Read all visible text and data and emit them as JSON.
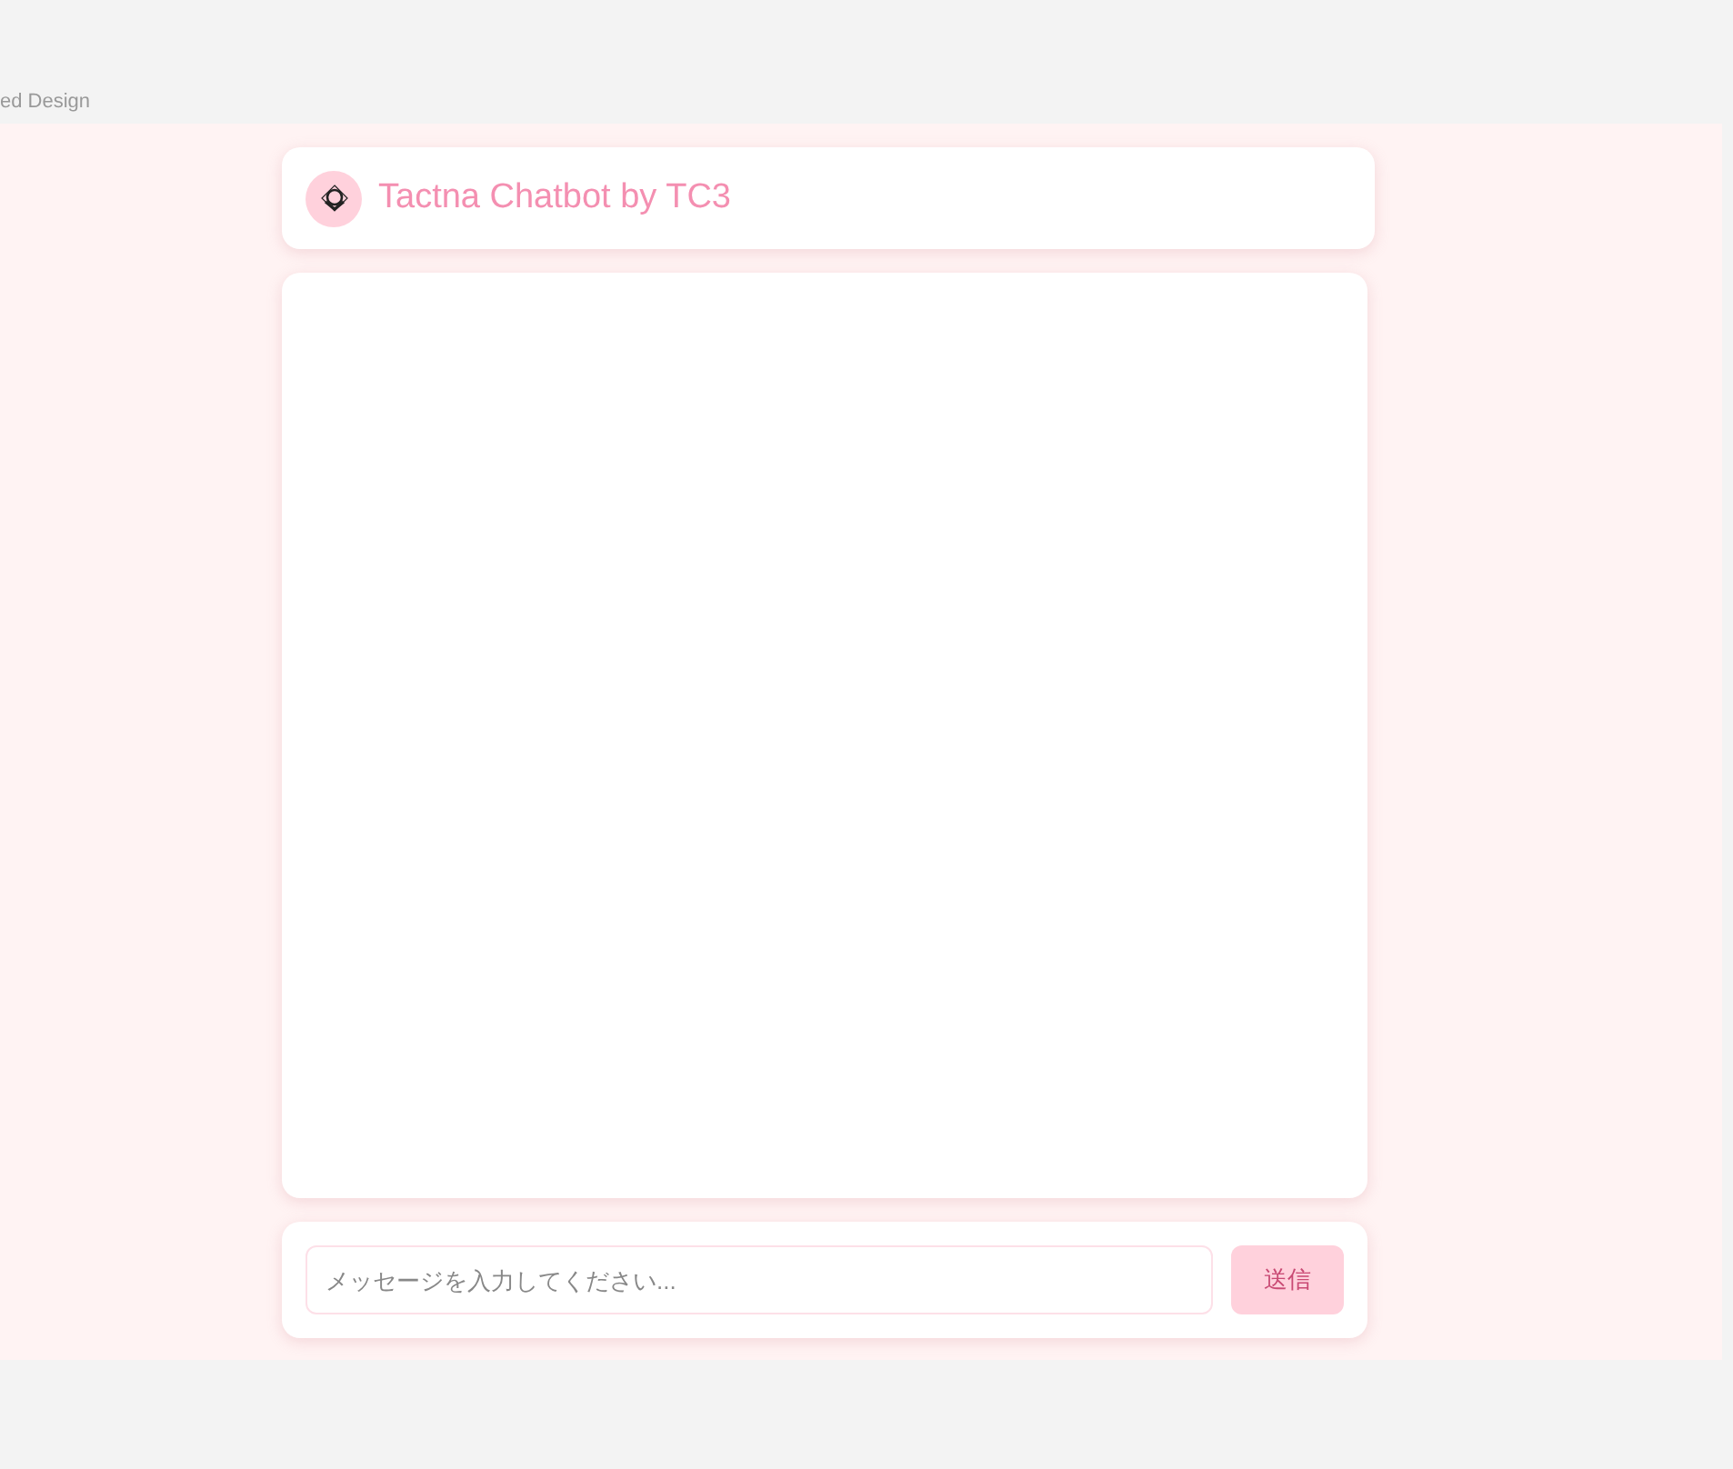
{
  "frame_label": "ed Design",
  "header": {
    "title": "Tactna Chatbot by TC3"
  },
  "composer": {
    "placeholder": "メッセージを入力してください...",
    "send_button": {
      "label": "送信",
      "disabled": true
    }
  }
}
